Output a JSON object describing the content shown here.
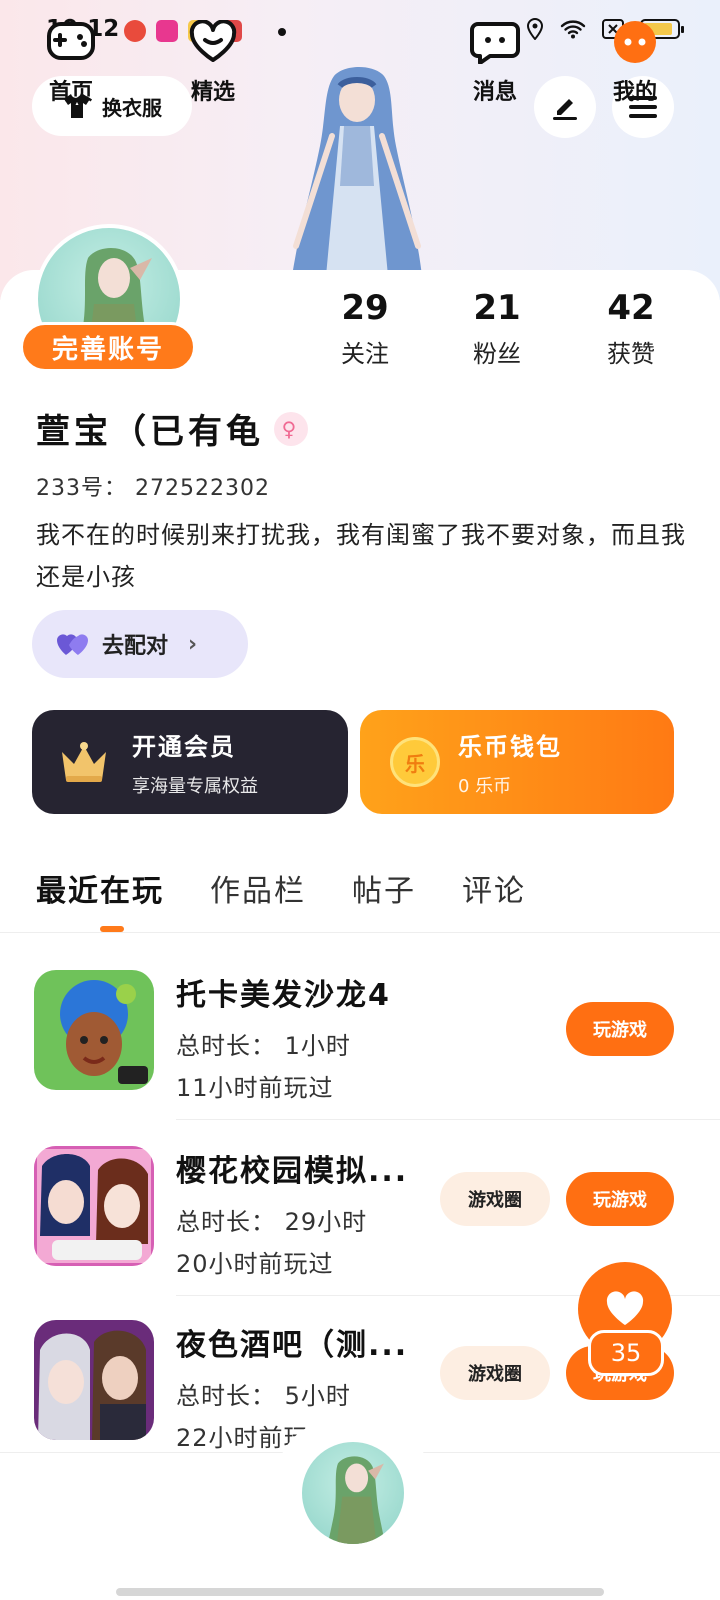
{
  "status_bar": {
    "time": "10:12"
  },
  "header": {
    "outfit_label": "换衣服"
  },
  "profile": {
    "complete_badge": "完善账号",
    "stats": [
      {
        "value": "29",
        "label": "关注"
      },
      {
        "value": "21",
        "label": "粉丝"
      },
      {
        "value": "42",
        "label": "获赞"
      }
    ],
    "nickname": "萱宝（已有龟",
    "gender_symbol": "♀",
    "uid": "233号： 272522302",
    "bio": "我不在的时候别来打扰我，我有闺蜜了我不要对象，而且我还是小孩",
    "match_button": "去配对",
    "match_chevron": "›"
  },
  "vip_card": {
    "title": "开通会员",
    "subtitle": "享海量专属权益"
  },
  "wallet_card": {
    "coin_glyph": "乐",
    "title": "乐币钱包",
    "subtitle": "0 乐币"
  },
  "tabs": [
    {
      "label": "最近在玩",
      "active": true
    },
    {
      "label": "作品栏",
      "active": false
    },
    {
      "label": "帖子",
      "active": false
    },
    {
      "label": "评论",
      "active": false
    }
  ],
  "games": [
    {
      "name": "托卡美发沙龙4",
      "time": "总时长： 1小时",
      "last": "11小时前玩过",
      "circle_btn": "",
      "play_btn": "玩游戏"
    },
    {
      "name": "樱花校园模拟...",
      "time": "总时长： 29小时",
      "last": "20小时前玩过",
      "circle_btn": "游戏圈",
      "play_btn": "玩游戏"
    },
    {
      "name": "夜色酒吧（测...",
      "time": "总时长： 5小时",
      "last": "22小时前玩过",
      "circle_btn": "游戏圈",
      "play_btn": "玩游戏"
    }
  ],
  "floating_like": {
    "count": "35"
  },
  "bottom_nav": [
    {
      "label": "首页",
      "icon": "gamepad-icon"
    },
    {
      "label": "精选",
      "icon": "heart-outline-icon"
    },
    {
      "label": "",
      "icon": "avatar"
    },
    {
      "label": "消息",
      "icon": "chat-icon"
    },
    {
      "label": "我的",
      "icon": "me-icon"
    }
  ],
  "colors": {
    "accent": "#ff6f12",
    "vip_bg": "#262431",
    "match_bg": "#e8e6fa"
  }
}
